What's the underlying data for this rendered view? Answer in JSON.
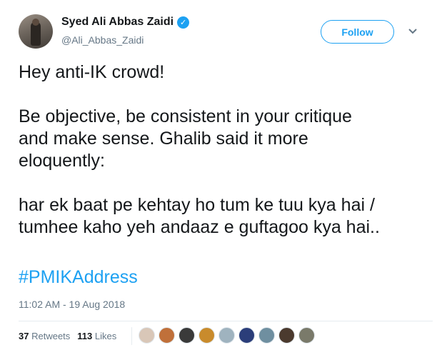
{
  "author": {
    "name": "Syed Ali Abbas Zaidi",
    "handle": "@Ali_Abbas_Zaidi",
    "verified_glyph": "✓"
  },
  "follow_button": {
    "label": "Follow"
  },
  "tweet": {
    "paragraphs": [
      [
        "Hey anti-IK crowd!"
      ],
      [
        "Be objective, be consistent in your critique",
        "and make sense. Ghalib said it more",
        "eloquently:"
      ],
      [
        "har ek baat pe kehtay ho tum ke tuu kya hai /",
        "tumhee kaho yeh andaaz e guftagoo kya hai.."
      ]
    ],
    "hashtag": "#PMIKAddress",
    "timestamp": "11:02 AM - 19 Aug 2018"
  },
  "stats": {
    "retweets_count": "37",
    "retweets_label": "Retweets",
    "likes_count": "113",
    "likes_label": "Likes"
  },
  "likers": [
    {
      "color": "#d9c7b8"
    },
    {
      "color": "#c0703a"
    },
    {
      "color": "#3a3a3a"
    },
    {
      "color": "#c98b2c"
    },
    {
      "color": "#9fb3bf"
    },
    {
      "color": "#2b3e7a"
    },
    {
      "color": "#6f8fa0"
    },
    {
      "color": "#4b3a2e"
    },
    {
      "color": "#7a7a6a"
    }
  ],
  "colors": {
    "accent": "#1da1f2",
    "text": "#14171a",
    "muted": "#657786"
  }
}
